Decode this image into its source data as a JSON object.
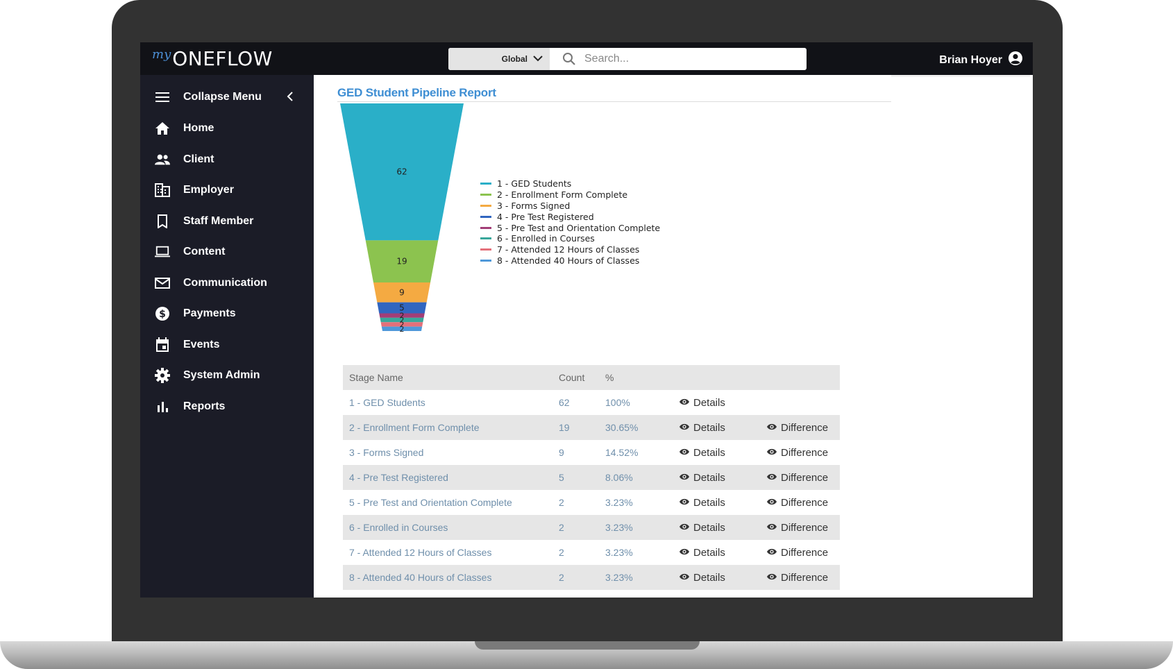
{
  "app": {
    "logo_prefix": "my",
    "logo_name": "ONEFLOW"
  },
  "header": {
    "scope_label": "Global",
    "search_placeholder": "Search...",
    "user_name": "Brian Hoyer",
    "icons": [
      "chevron-down-icon",
      "search-icon",
      "user-account-icon"
    ]
  },
  "sidebar": {
    "items": [
      {
        "label": "Collapse Menu",
        "icon": "menu-icon"
      },
      {
        "label": "Home",
        "icon": "home-icon"
      },
      {
        "label": "Client",
        "icon": "people-icon"
      },
      {
        "label": "Employer",
        "icon": "building-icon"
      },
      {
        "label": "Staff Member",
        "icon": "bookmark-icon"
      },
      {
        "label": "Content",
        "icon": "laptop-icon"
      },
      {
        "label": "Communication",
        "icon": "mail-icon"
      },
      {
        "label": "Payments",
        "icon": "dollar-icon"
      },
      {
        "label": "Events",
        "icon": "calendar-icon"
      },
      {
        "label": "System Admin",
        "icon": "gear-icon"
      },
      {
        "label": "Reports",
        "icon": "bar-chart-icon"
      }
    ]
  },
  "report": {
    "title": "GED Student Pipeline Report",
    "table": {
      "headers": [
        "Stage Name",
        "Count",
        "%"
      ],
      "details_label": "Details",
      "difference_label": "Difference",
      "rows": [
        {
          "stage": "1 - GED Students",
          "count": "62",
          "pct": "100%",
          "difference": false
        },
        {
          "stage": "2 - Enrollment Form Complete",
          "count": "19",
          "pct": "30.65%",
          "difference": true
        },
        {
          "stage": "3 - Forms Signed",
          "count": "9",
          "pct": "14.52%",
          "difference": true
        },
        {
          "stage": "4 - Pre Test Registered",
          "count": "5",
          "pct": "8.06%",
          "difference": true
        },
        {
          "stage": "5 - Pre Test and Orientation Complete",
          "count": "2",
          "pct": "3.23%",
          "difference": true
        },
        {
          "stage": "6 - Enrolled in Courses",
          "count": "2",
          "pct": "3.23%",
          "difference": true
        },
        {
          "stage": "7 - Attended 12 Hours of Classes",
          "count": "2",
          "pct": "3.23%",
          "difference": true
        },
        {
          "stage": "8 - Attended 40 Hours of Classes",
          "count": "2",
          "pct": "3.23%",
          "difference": true
        }
      ]
    }
  },
  "chart_data": {
    "type": "funnel",
    "categories": [
      "1 - GED Students",
      "2 - Enrollment Form Complete",
      "3 - Forms Signed",
      "4 - Pre Test Registered",
      "5 - Pre Test and Orientation Complete",
      "6 - Enrolled in Courses",
      "7 - Attended 12 Hours of Classes",
      "8 - Attended 40 Hours of Classes"
    ],
    "values": [
      62,
      19,
      9,
      5,
      2,
      2,
      2,
      2
    ],
    "colors": [
      "#2aafc8",
      "#8cc34f",
      "#f4aa42",
      "#3166c0",
      "#a23e77",
      "#39a79b",
      "#e4707a",
      "#4f98d9"
    ],
    "legend_position": "right"
  }
}
